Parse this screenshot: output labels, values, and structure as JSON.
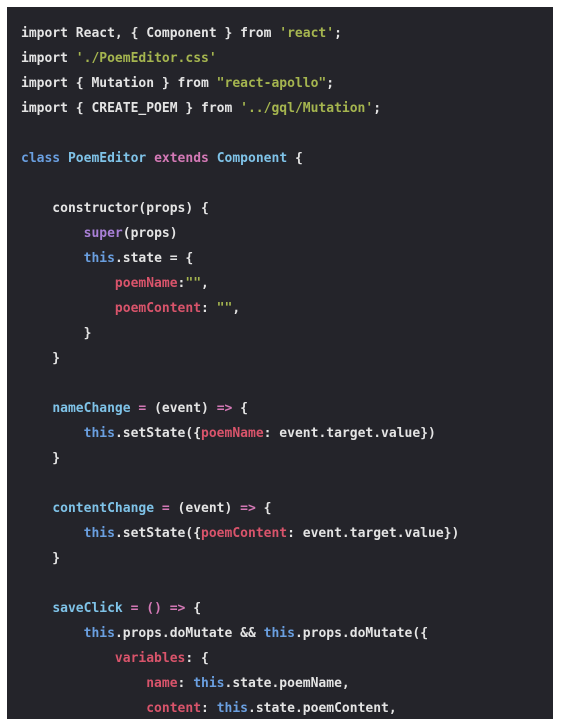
{
  "document": {
    "kind": "code-screenshot",
    "language": "jsx",
    "background_color": "#24242a",
    "page_background_color": "#ffffff",
    "default_text_color": "#e4e4e4"
  },
  "theme": {
    "keyword": "#6a9fe0",
    "operator": "#d479b6",
    "classname": "#7fc3e8",
    "string": "#a5b54f",
    "property": "#d9546b",
    "builtin": "#a87fd6",
    "plain": "#e4e4e4"
  },
  "code": {
    "lines": [
      {
        "id": 1,
        "text": "import React, { Component } from 'react';",
        "tokens": [
          {
            "t": "import React, { Component } from ",
            "c": "plain"
          },
          {
            "t": "'react'",
            "c": "string"
          },
          {
            "t": ";",
            "c": "plain"
          }
        ]
      },
      {
        "id": 2,
        "text": "import './PoemEditor.css'",
        "tokens": [
          {
            "t": "import ",
            "c": "plain"
          },
          {
            "t": "'./PoemEditor.css'",
            "c": "string"
          }
        ]
      },
      {
        "id": 3,
        "text": "import { Mutation } from \"react-apollo\";",
        "tokens": [
          {
            "t": "import { Mutation } from ",
            "c": "plain"
          },
          {
            "t": "\"react-apollo\"",
            "c": "string"
          },
          {
            "t": ";",
            "c": "plain"
          }
        ]
      },
      {
        "id": 4,
        "text": "import { CREATE_POEM } from '../gql/Mutation';",
        "tokens": [
          {
            "t": "import { CREATE_POEM } from ",
            "c": "plain"
          },
          {
            "t": "'../gql/Mutation'",
            "c": "string"
          },
          {
            "t": ";",
            "c": "plain"
          }
        ]
      },
      {
        "id": 5,
        "text": "",
        "tokens": []
      },
      {
        "id": 6,
        "text": "class PoemEditor extends Component {",
        "tokens": [
          {
            "t": "class",
            "c": "keyword"
          },
          {
            "t": " ",
            "c": "plain"
          },
          {
            "t": "PoemEditor",
            "c": "classname"
          },
          {
            "t": " ",
            "c": "plain"
          },
          {
            "t": "extends",
            "c": "operator"
          },
          {
            "t": " ",
            "c": "plain"
          },
          {
            "t": "Component",
            "c": "classname"
          },
          {
            "t": " {",
            "c": "plain"
          }
        ]
      },
      {
        "id": 7,
        "text": "",
        "tokens": []
      },
      {
        "id": 8,
        "text": "    constructor(props) {",
        "tokens": [
          {
            "t": "    constructor(props) {",
            "c": "plain"
          }
        ]
      },
      {
        "id": 9,
        "text": "        super(props)",
        "tokens": [
          {
            "t": "        ",
            "c": "plain"
          },
          {
            "t": "super",
            "c": "builtin"
          },
          {
            "t": "(props)",
            "c": "plain"
          }
        ]
      },
      {
        "id": 10,
        "text": "        this.state = {",
        "tokens": [
          {
            "t": "        ",
            "c": "plain"
          },
          {
            "t": "this",
            "c": "keyword"
          },
          {
            "t": ".state = {",
            "c": "plain"
          }
        ]
      },
      {
        "id": 11,
        "text": "            poemName:\"\",",
        "tokens": [
          {
            "t": "            ",
            "c": "plain"
          },
          {
            "t": "poemName",
            "c": "property"
          },
          {
            "t": ":",
            "c": "plain"
          },
          {
            "t": "\"\"",
            "c": "string"
          },
          {
            "t": ",",
            "c": "plain"
          }
        ]
      },
      {
        "id": 12,
        "text": "            poemContent: \"\",",
        "tokens": [
          {
            "t": "            ",
            "c": "plain"
          },
          {
            "t": "poemContent",
            "c": "property"
          },
          {
            "t": ": ",
            "c": "plain"
          },
          {
            "t": "\"\"",
            "c": "string"
          },
          {
            "t": ",",
            "c": "plain"
          }
        ]
      },
      {
        "id": 13,
        "text": "        }",
        "tokens": [
          {
            "t": "        }",
            "c": "plain"
          }
        ]
      },
      {
        "id": 14,
        "text": "    }",
        "tokens": [
          {
            "t": "    }",
            "c": "plain"
          }
        ]
      },
      {
        "id": 15,
        "text": "",
        "tokens": []
      },
      {
        "id": 16,
        "text": "    nameChange = (event) => {",
        "tokens": [
          {
            "t": "    ",
            "c": "plain"
          },
          {
            "t": "nameChange",
            "c": "classname"
          },
          {
            "t": " ",
            "c": "plain"
          },
          {
            "t": "=",
            "c": "operator"
          },
          {
            "t": " (event) ",
            "c": "plain"
          },
          {
            "t": "=>",
            "c": "operator"
          },
          {
            "t": " {",
            "c": "plain"
          }
        ]
      },
      {
        "id": 17,
        "text": "        this.setState({poemName: event.target.value})",
        "tokens": [
          {
            "t": "        ",
            "c": "plain"
          },
          {
            "t": "this",
            "c": "keyword"
          },
          {
            "t": ".setState({",
            "c": "plain"
          },
          {
            "t": "poemName",
            "c": "property"
          },
          {
            "t": ": event.target.value})",
            "c": "plain"
          }
        ]
      },
      {
        "id": 18,
        "text": "    }",
        "tokens": [
          {
            "t": "    }",
            "c": "plain"
          }
        ]
      },
      {
        "id": 19,
        "text": "",
        "tokens": []
      },
      {
        "id": 20,
        "text": "    contentChange = (event) => {",
        "tokens": [
          {
            "t": "    ",
            "c": "plain"
          },
          {
            "t": "contentChange",
            "c": "classname"
          },
          {
            "t": " ",
            "c": "plain"
          },
          {
            "t": "=",
            "c": "operator"
          },
          {
            "t": " (event) ",
            "c": "plain"
          },
          {
            "t": "=>",
            "c": "operator"
          },
          {
            "t": " {",
            "c": "plain"
          }
        ]
      },
      {
        "id": 21,
        "text": "        this.setState({poemContent: event.target.value})",
        "tokens": [
          {
            "t": "        ",
            "c": "plain"
          },
          {
            "t": "this",
            "c": "keyword"
          },
          {
            "t": ".setState({",
            "c": "plain"
          },
          {
            "t": "poemContent",
            "c": "property"
          },
          {
            "t": ": event.target.value})",
            "c": "plain"
          }
        ]
      },
      {
        "id": 22,
        "text": "    }",
        "tokens": [
          {
            "t": "    }",
            "c": "plain"
          }
        ]
      },
      {
        "id": 23,
        "text": "",
        "tokens": []
      },
      {
        "id": 24,
        "text": "    saveClick = () => {",
        "tokens": [
          {
            "t": "    ",
            "c": "plain"
          },
          {
            "t": "saveClick",
            "c": "classname"
          },
          {
            "t": " ",
            "c": "plain"
          },
          {
            "t": "=",
            "c": "operator"
          },
          {
            "t": " ",
            "c": "plain"
          },
          {
            "t": "()",
            "c": "operator"
          },
          {
            "t": " ",
            "c": "plain"
          },
          {
            "t": "=>",
            "c": "operator"
          },
          {
            "t": " {",
            "c": "plain"
          }
        ]
      },
      {
        "id": 25,
        "text": "        this.props.doMutate && this.props.doMutate({",
        "tokens": [
          {
            "t": "        ",
            "c": "plain"
          },
          {
            "t": "this",
            "c": "keyword"
          },
          {
            "t": ".props.doMutate && ",
            "c": "plain"
          },
          {
            "t": "this",
            "c": "keyword"
          },
          {
            "t": ".props.doMutate({",
            "c": "plain"
          }
        ]
      },
      {
        "id": 26,
        "text": "            variables: {",
        "tokens": [
          {
            "t": "            ",
            "c": "plain"
          },
          {
            "t": "variables",
            "c": "property"
          },
          {
            "t": ": {",
            "c": "plain"
          }
        ]
      },
      {
        "id": 27,
        "text": "                name: this.state.poemName,",
        "tokens": [
          {
            "t": "                ",
            "c": "plain"
          },
          {
            "t": "name",
            "c": "property"
          },
          {
            "t": ": ",
            "c": "plain"
          },
          {
            "t": "this",
            "c": "keyword"
          },
          {
            "t": ".state.poemName,",
            "c": "plain"
          }
        ]
      },
      {
        "id": 28,
        "text": "                content: this.state.poemContent,",
        "tokens": [
          {
            "t": "                ",
            "c": "plain"
          },
          {
            "t": "content",
            "c": "property"
          },
          {
            "t": ": ",
            "c": "plain"
          },
          {
            "t": "this",
            "c": "keyword"
          },
          {
            "t": ".state.poemContent,",
            "c": "plain"
          }
        ]
      }
    ]
  }
}
